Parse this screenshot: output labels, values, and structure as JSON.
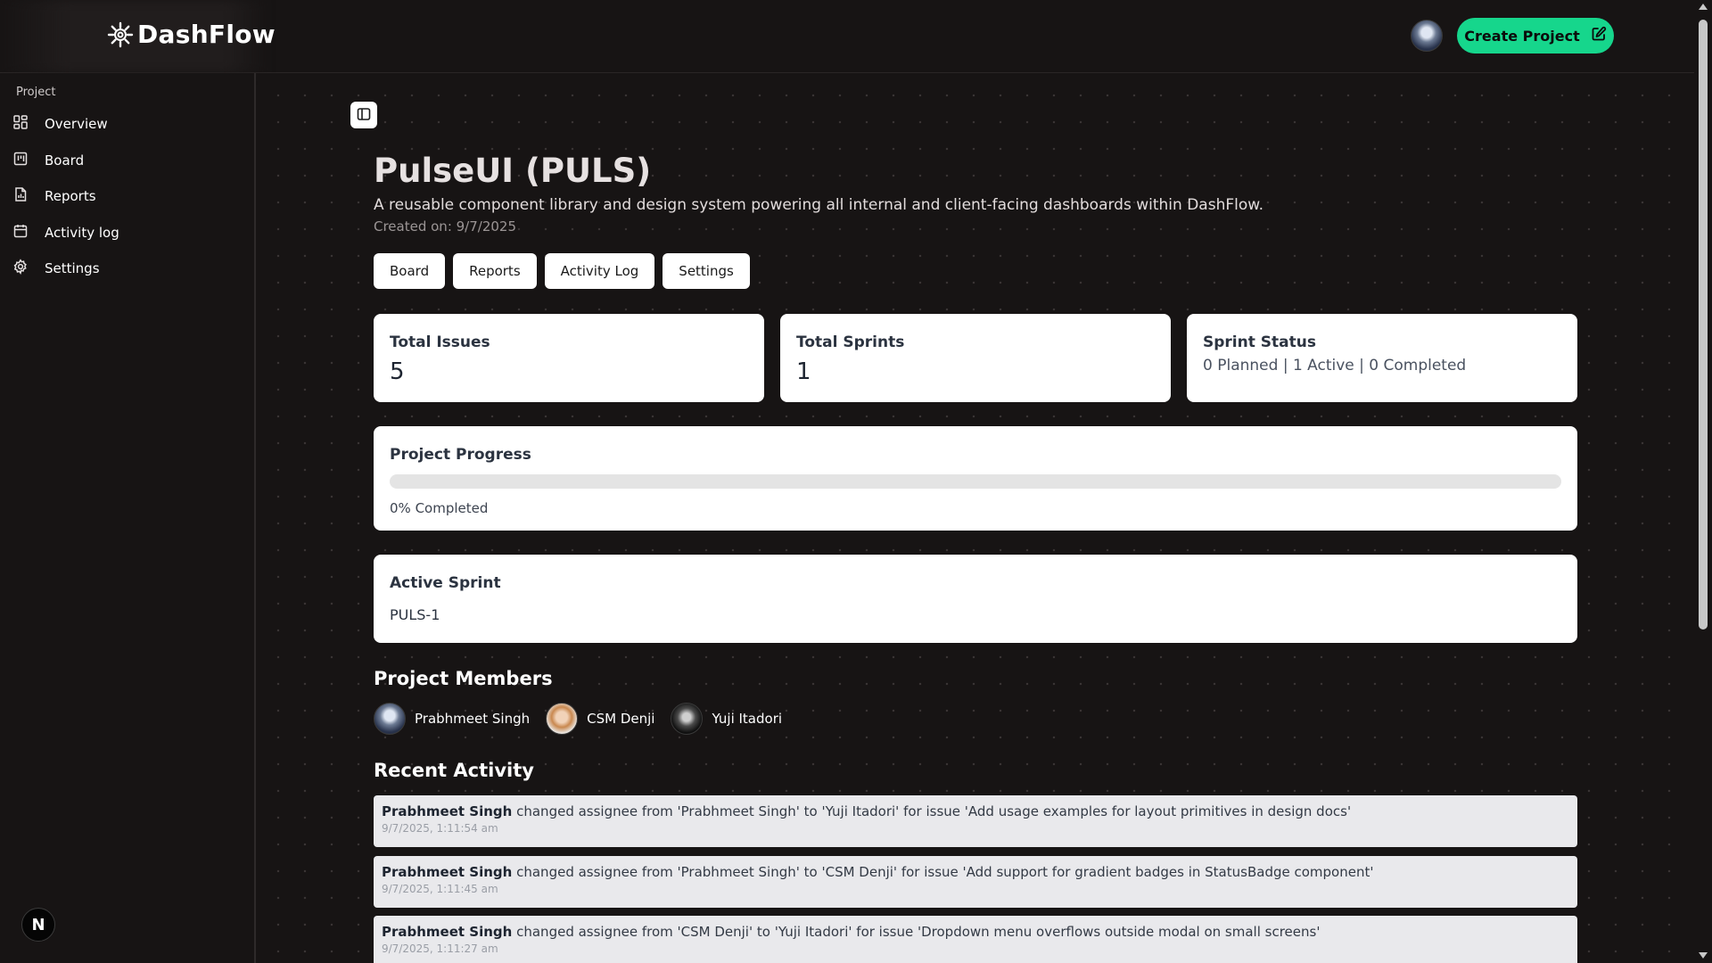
{
  "app": {
    "name": "DashFlow",
    "create_button_label": "Create Project"
  },
  "sidebar": {
    "heading": "Project",
    "items": [
      {
        "label": "Overview",
        "icon": "grid-icon"
      },
      {
        "label": "Board",
        "icon": "board-icon"
      },
      {
        "label": "Reports",
        "icon": "report-icon"
      },
      {
        "label": "Activity log",
        "icon": "calendar-icon"
      },
      {
        "label": "Settings",
        "icon": "gear-icon"
      }
    ],
    "footer_badge": "N"
  },
  "project": {
    "title": "PulseUI (PULS)",
    "description": "A reusable component library and design system powering all internal and client-facing dashboards within DashFlow.",
    "created": "Created on: 9/7/2025",
    "tabs": [
      "Board",
      "Reports",
      "Activity Log",
      "Settings"
    ]
  },
  "stats": {
    "total_issues_label": "Total Issues",
    "total_issues_value": "5",
    "total_sprints_label": "Total Sprints",
    "total_sprints_value": "1",
    "sprint_status_label": "Sprint Status",
    "sprint_status_value": "0 Planned | 1 Active | 0 Completed"
  },
  "progress": {
    "label": "Project Progress",
    "percent": 0,
    "text": "0% Completed"
  },
  "active_sprint": {
    "label": "Active Sprint",
    "name": "PULS-1"
  },
  "members": {
    "heading": "Project Members",
    "list": [
      {
        "name": "Prabhmeet Singh"
      },
      {
        "name": "CSM Denji"
      },
      {
        "name": "Yuji Itadori"
      }
    ]
  },
  "activity": {
    "heading": "Recent Activity",
    "items": [
      {
        "user": "Prabhmeet Singh",
        "text": " changed assignee from 'Prabhmeet Singh' to 'Yuji Itadori' for issue 'Add usage examples for layout primitives in design docs'",
        "time": "9/7/2025, 1:11:54 am"
      },
      {
        "user": "Prabhmeet Singh",
        "text": " changed assignee from 'Prabhmeet Singh' to 'CSM Denji' for issue 'Add support for gradient badges in StatusBadge component'",
        "time": "9/7/2025, 1:11:45 am"
      },
      {
        "user": "Prabhmeet Singh",
        "text": " changed assignee from 'CSM Denji' to 'Yuji Itadori' for issue 'Dropdown menu overflows outside modal on small screens'",
        "time": "9/7/2025, 1:11:27 am"
      }
    ]
  },
  "colors": {
    "accent": "#16d68c",
    "background": "#171414",
    "card": "#ffffff"
  }
}
